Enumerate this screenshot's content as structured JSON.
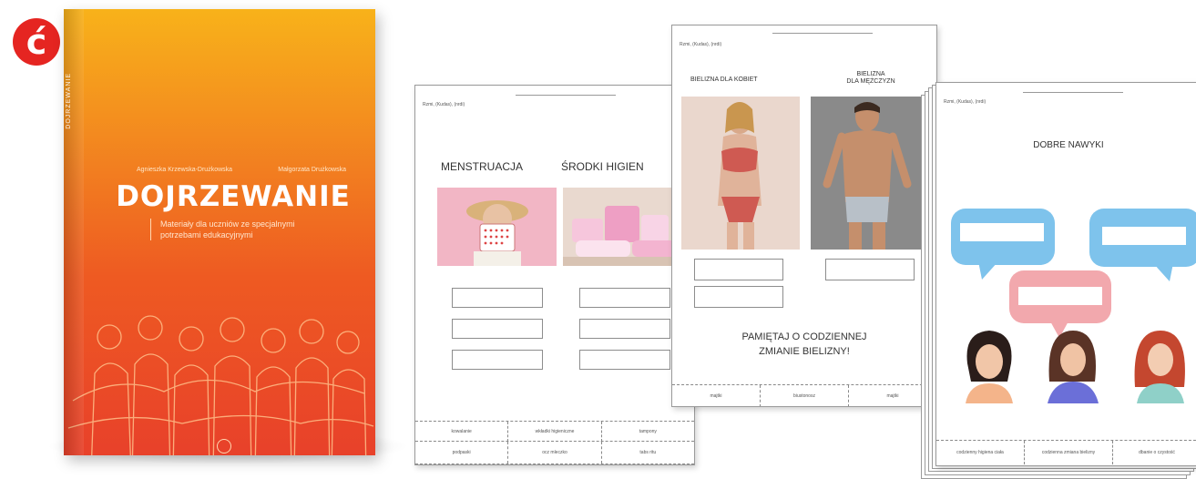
{
  "logo": {
    "glyph": "ć",
    "color": "#e52521"
  },
  "book": {
    "spine_text": "DOJRZEWANIE",
    "author_1": "Agnieszka Krzewska-Drużkowska",
    "author_2": "Małgorzata Drużkowska",
    "title": "DOJRZEWANIE",
    "subtitle": "Materiały dla uczniów ze specjalnymi potrzebami edukacyjnymi",
    "colors": {
      "top": "#f8b21a",
      "bottom": "#e8412a"
    }
  },
  "sheet1": {
    "name_line": "Rzmi, (Kudas), (nrdi)",
    "heading_a": "MENSTRUACJA",
    "heading_b": "ŚRODKI HIGIEN",
    "cut_rows": [
      [
        "kowalanie",
        "wkładki higieniczne",
        "tampony"
      ],
      [
        "podpaski",
        "ocz mleczko",
        "tabs ritu"
      ]
    ]
  },
  "sheet2": {
    "name_line": "Rzmi, (Kudas), (nrdi)",
    "heading_women": "BIELIZNA DLA KOBIET",
    "heading_men_1": "BIELIZNA",
    "heading_men_2": "DLA MĘŻCZYZN",
    "reminder_1": "PAMIĘTAJ O CODZIENNEJ",
    "reminder_2": "ZMIANIE BIELIZNY!",
    "cut_row": [
      "majtki",
      "biustonosz",
      "majtki"
    ]
  },
  "sheet3": {
    "name_line": "Rzmi, (Kudas), (nrdi)",
    "heading": "DOBRE NAWYKI",
    "cut_row": [
      "codzienny higiena ciała",
      "codzienna zmiana bielizny",
      "dbanie o czystość"
    ]
  }
}
